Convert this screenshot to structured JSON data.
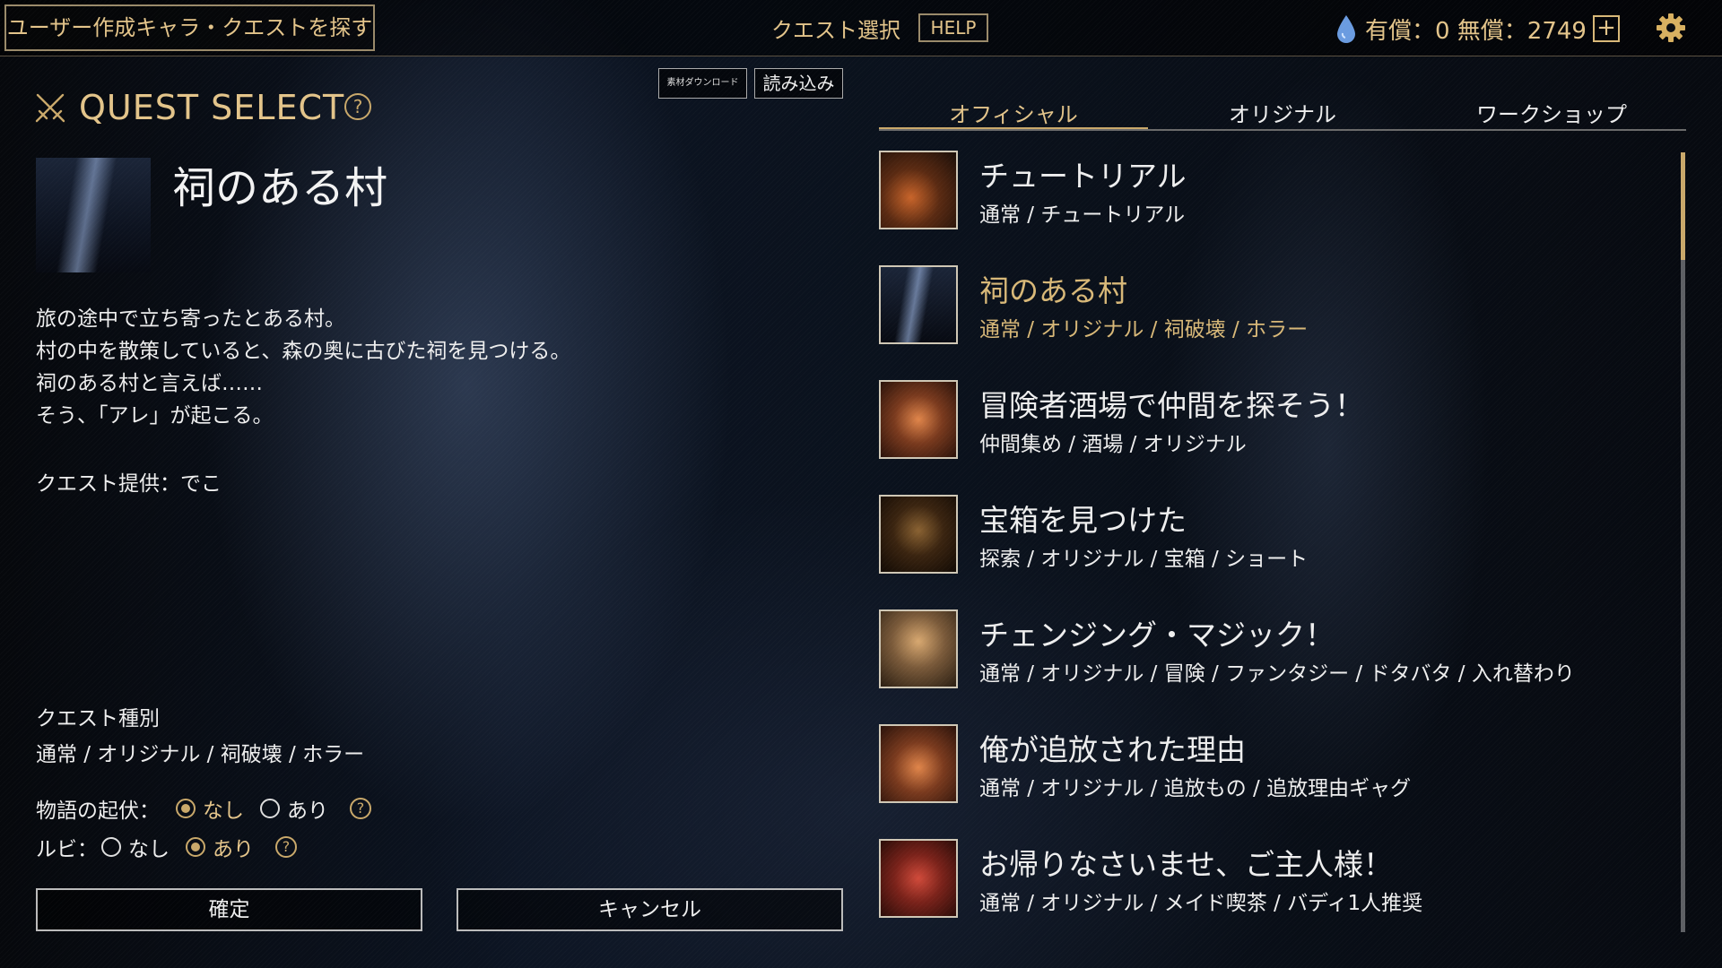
{
  "topbar": {
    "search_user_label": "ユーザー作成キャラ・クエストを探す",
    "screen_title": "クエスト選択",
    "help_label": "HELP",
    "currency_text": "有償：0 無償：2749",
    "plus_label": "+",
    "icons": {
      "currency": "water-drop-icon",
      "settings": "gear-icon"
    }
  },
  "left": {
    "header": "QUEST SELECT",
    "help_mark": "?",
    "download_label": "素材ダウンロード",
    "load_label": "読み込み",
    "selected_title": "祠のある村",
    "description": [
      "旅の途中で立ち寄ったとある村。",
      "村の中を散策していると、森の奥に古びた祠を見つける。",
      "祠のある村と言えば……",
      "そう、「アレ」が起こる。"
    ],
    "provider": "クエスト提供：でこ",
    "type_label": "クエスト種別",
    "type_value": "通常 / オリジナル / 祠破壊 / ホラー",
    "story_option": {
      "label": "物語の起伏：",
      "opt1": "なし",
      "opt2": "あり",
      "selected": "なし"
    },
    "ruby_option": {
      "label": "ルビ：",
      "opt1": "なし",
      "opt2": "あり",
      "selected": "あり"
    },
    "ok_label": "確定",
    "cancel_label": "キャンセル"
  },
  "tabs": [
    {
      "label": "オフィシャル",
      "active": true
    },
    {
      "label": "オリジナル",
      "active": false
    },
    {
      "label": "ワークショップ",
      "active": false
    }
  ],
  "quests": [
    {
      "title": "チュートリアル",
      "tags": "通常 / チュートリアル",
      "selected": false
    },
    {
      "title": "祠のある村",
      "tags": "通常 / オリジナル / 祠破壊 / ホラー",
      "selected": true
    },
    {
      "title": "冒険者酒場で仲間を探そう！",
      "tags": "仲間集め / 酒場 / オリジナル",
      "selected": false
    },
    {
      "title": "宝箱を見つけた",
      "tags": "探索 / オリジナル / 宝箱 / ショート",
      "selected": false
    },
    {
      "title": "チェンジング・マジック！",
      "tags": "通常 / オリジナル / 冒険 / ファンタジー / ドタバタ / 入れ替わり",
      "selected": false
    },
    {
      "title": "俺が追放された理由",
      "tags": "通常 / オリジナル / 追放もの / 追放理由ギャグ",
      "selected": false
    },
    {
      "title": "お帰りなさいませ、ご主人様！",
      "tags": "通常 / オリジナル / メイド喫茶 / バディ1人推奨",
      "selected": false
    }
  ],
  "colors": {
    "accent": "#e3c48a",
    "text": "#eeeeee"
  }
}
